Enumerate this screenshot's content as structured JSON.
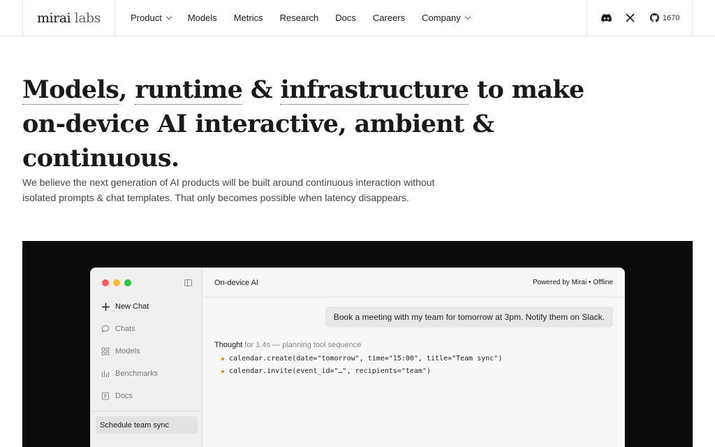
{
  "nav": {
    "logo_main": "mirai",
    "logo_sub": " labs",
    "links": [
      {
        "label": "Product",
        "dropdown": true
      },
      {
        "label": "Models",
        "dropdown": false
      },
      {
        "label": "Metrics",
        "dropdown": false
      },
      {
        "label": "Research",
        "dropdown": false
      },
      {
        "label": "Docs",
        "dropdown": false
      },
      {
        "label": "Careers",
        "dropdown": false
      },
      {
        "label": "Company",
        "dropdown": true
      }
    ],
    "github_stars": "1670",
    "social_icons": [
      "discord-icon",
      "x-icon",
      "github-icon"
    ]
  },
  "hero": {
    "h_models": "Models",
    "h_comma": ", ",
    "h_runtime": "runtime",
    "h_amp": " & ",
    "h_infra": "infrastructure",
    "h_tail": " to make",
    "h_line2": "on-device AI interactive, ambient & continuous.",
    "lede_1": "We believe the next generation of AI products will be built around continuous interaction without",
    "lede_2": "isolated prompts & chat templates. That only becomes possible when latency disappears."
  },
  "demo": {
    "sidebar": {
      "items": [
        {
          "label": "New Chat",
          "icon": "plus-icon"
        },
        {
          "label": "Chats",
          "icon": "chat-bubble-icon"
        },
        {
          "label": "Models",
          "icon": "grid-icon"
        },
        {
          "label": "Benchmarks",
          "icon": "bar-chart-icon"
        },
        {
          "label": "Docs",
          "icon": "document-icon"
        }
      ],
      "recent": "Schedule team sync"
    },
    "header_title": "On-device AI",
    "header_status": "Powered by Mirai • Offline",
    "user_message": "Book a meeting with my team for tomorrow at 3pm. Notify them on Slack.",
    "thought_label": "Thought",
    "thought_meta": " for 1.4s — planning tool sequence",
    "tool_calls": [
      "calendar.create(date=\"tomorrow\", time=\"15:00\", title=\"Team sync\")",
      "calendar.invite(event_id=\"…\", recipients=\"team\")"
    ]
  },
  "colors": {
    "traffic_red": "#ff5f57",
    "traffic_yellow": "#febc2e",
    "traffic_green": "#28c840",
    "tool_bullet": "#e0902a",
    "stage_bg": "#0b0b0b"
  }
}
